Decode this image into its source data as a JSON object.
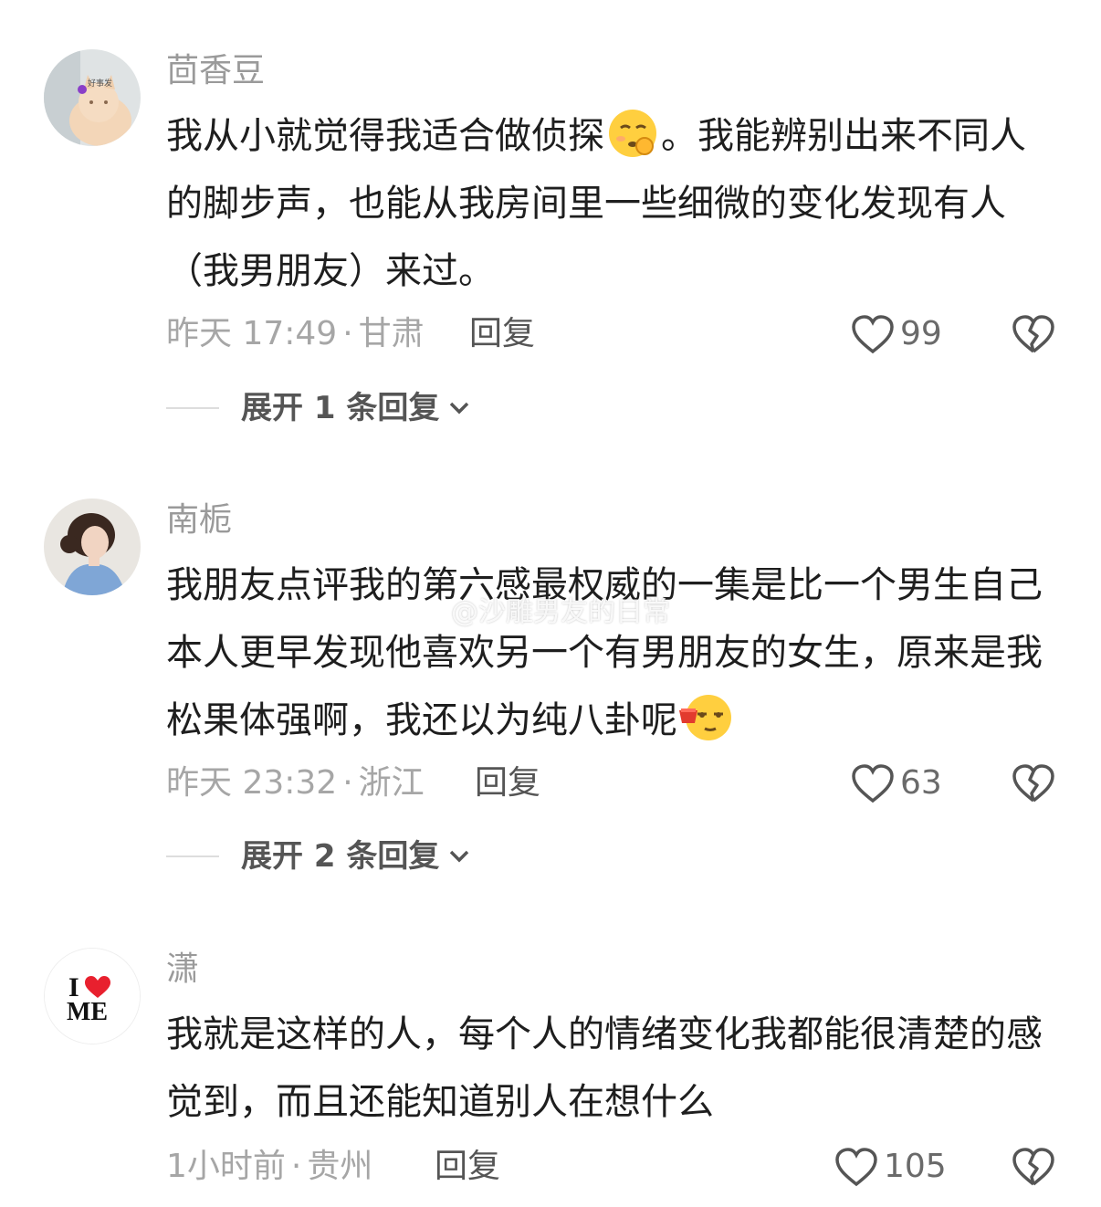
{
  "comments": [
    {
      "username": "茴香豆",
      "avatar_desc": "cat-avatar",
      "text_before_emoji": "我从小就觉得我适合做侦探",
      "text_after_emoji": "。我能辨别出来不同人的脚步声，也能从我房间里一些细微的变化发现有人（我男朋友）来过。",
      "emoji": "thinking-face-emoji",
      "time": "昨天 17:49",
      "location": "甘肃",
      "reply_label": "回复",
      "likes": "99",
      "expand_label": "展开 1 条回复"
    },
    {
      "username": "南栀",
      "avatar_desc": "woman-portrait-avatar",
      "text_before_emoji": "我朋友点评我的第六感最权威的一集是比一个男生自己本人更早发现他喜欢另一个有男朋友的女生，原来是我松果体强啊，我还以为纯八卦呢",
      "text_after_emoji": "",
      "emoji": "tea-sipping-face-emoji",
      "time": "昨天 23:32",
      "location": "浙江",
      "reply_label": "回复",
      "likes": "63",
      "expand_label": "展开 2 条回复"
    },
    {
      "username": "潇",
      "avatar_desc": "i-love-me-avatar",
      "text_before_emoji": "我就是这样的人，每个人的情绪变化我都能很清楚的感觉到，而且还能知道别人在想什么",
      "text_after_emoji": "",
      "time": "1小时前",
      "location": "贵州",
      "reply_label": "回复",
      "likes": "105"
    }
  ],
  "avatar3": {
    "line1": "I",
    "line2": "ME"
  },
  "dot_separator": "·",
  "watermark": "@沙雕男友的日常",
  "colors": {
    "meta": "#a6a6a6",
    "text": "#1e1e1e",
    "heart_red": "#e8202e"
  }
}
